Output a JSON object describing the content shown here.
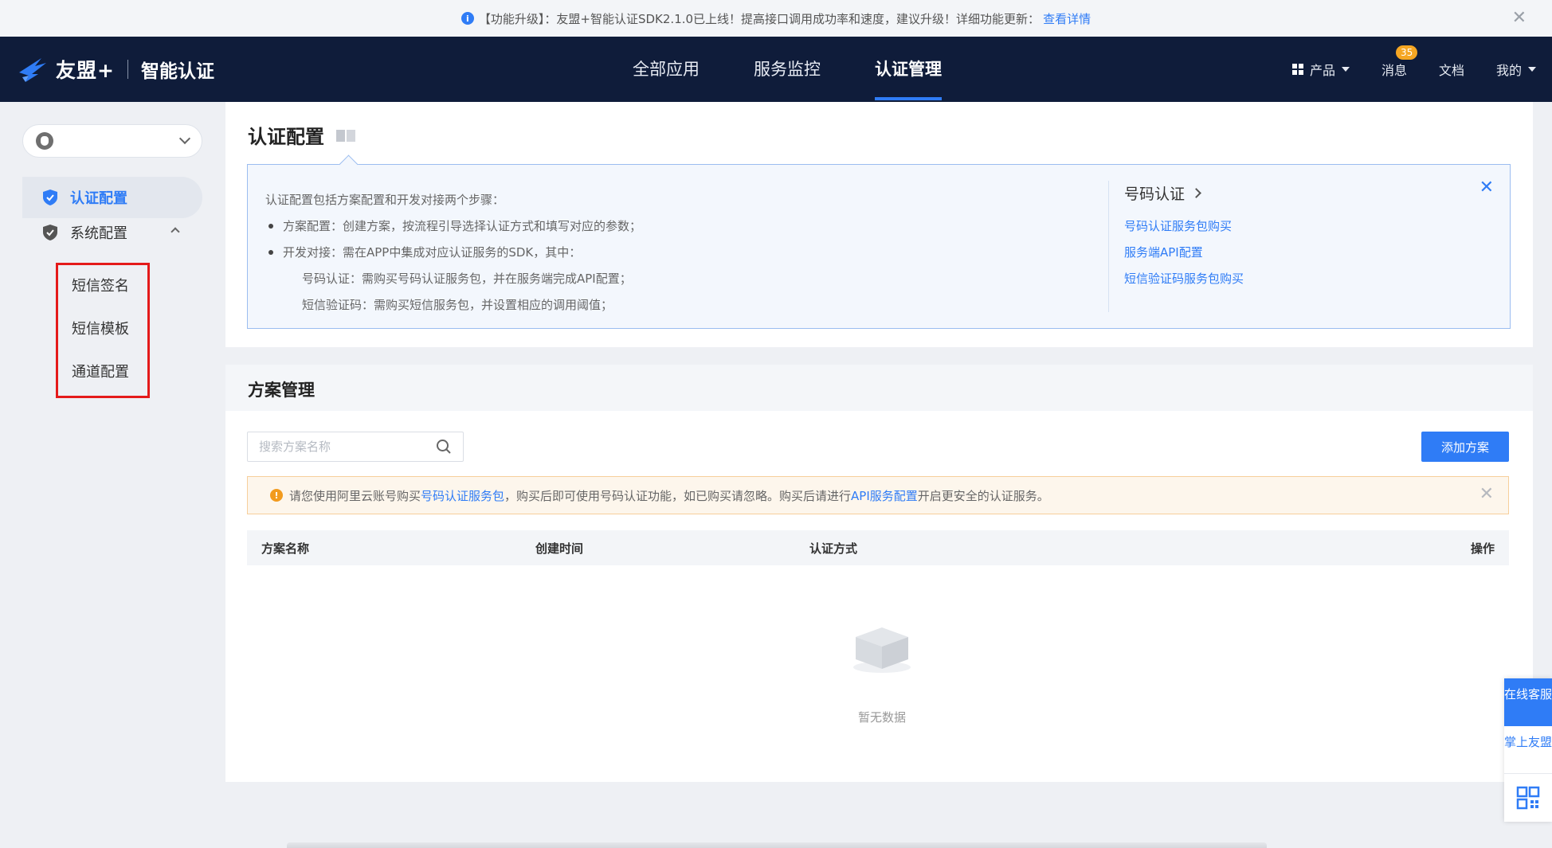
{
  "announcement": {
    "text": "【功能升级】：友盟+智能认证SDK2.1.0已上线！提高接口调用成功率和速度，建议升级！详细功能更新：",
    "link": "查看详情",
    "close": "✕"
  },
  "header": {
    "brand": "友盟+",
    "product": "智能认证",
    "nav": [
      "全部应用",
      "服务监控",
      "认证管理"
    ],
    "active_nav": "认证管理",
    "products_label": "产品",
    "messages_label": "消息",
    "messages_badge": "35",
    "docs_label": "文档",
    "mine_label": "我的"
  },
  "sidebar": {
    "items": [
      {
        "label": "认证配置",
        "active": true
      },
      {
        "label": "系统配置",
        "active": false
      }
    ],
    "sub_items": [
      "短信签名",
      "短信模板",
      "通道配置"
    ]
  },
  "config_panel": {
    "title": "认证配置",
    "intro": "认证配置包括方案配置和开发对接两个步骤：",
    "step1": "方案配置：创建方案，按流程引导选择认证方式和填写对应的参数；",
    "step2": "开发对接：需在APP中集成对应认证服务的SDK，其中：",
    "step2a": "号码认证：需购买号码认证服务包，并在服务端完成API配置；",
    "step2b": "短信验证码：需购买短信服务包，并设置相应的调用阈值；",
    "quick_title": "号码认证",
    "quick_links": [
      "号码认证服务包购买",
      "服务端API配置",
      "短信验证码服务包购买"
    ],
    "close": "✕"
  },
  "plan_panel": {
    "title": "方案管理",
    "search_placeholder": "搜索方案名称",
    "add_button": "添加方案",
    "warning_pre": "请您使用阿里云账号购买",
    "warning_link1": "号码认证服务包",
    "warning_mid": "，购买后即可使用号码认证功能，如已购买请忽略。购买后请进行 ",
    "warning_link2": "API服务配置",
    "warning_post": " 开启更安全的认证服务。",
    "warning_close": "✕",
    "columns": [
      "方案名称",
      "创建时间",
      "认证方式",
      "操作"
    ],
    "empty_text": "暂无数据"
  },
  "float_bar": {
    "chat": "在线客服",
    "app": "掌上友盟"
  },
  "colors": {
    "accent": "#2f7cf6",
    "header_bg": "#0f1c3a",
    "warning": "#f29b1e"
  }
}
